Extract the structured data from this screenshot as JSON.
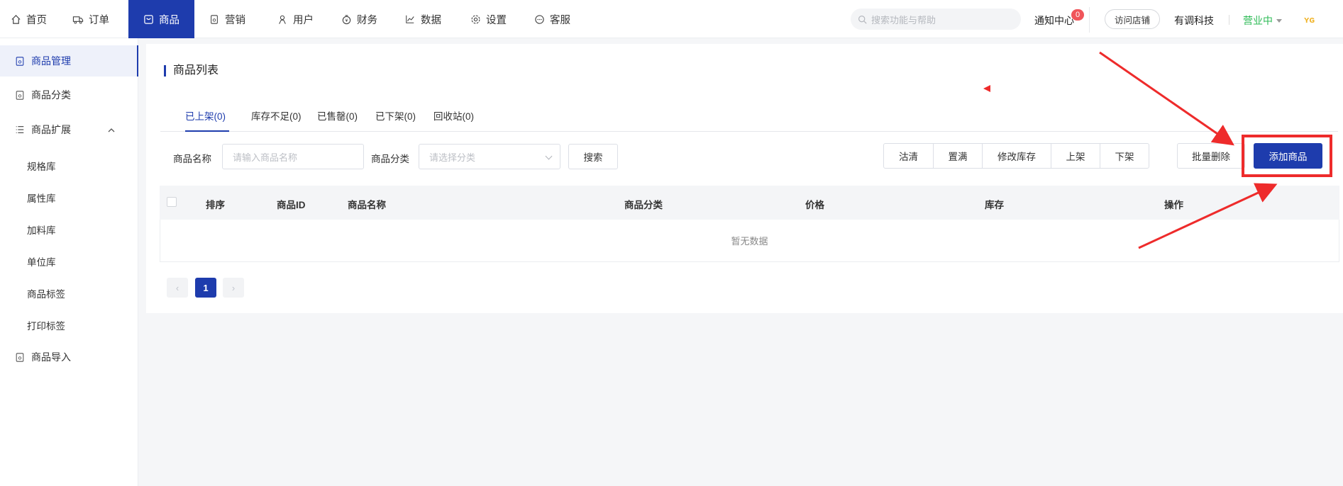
{
  "nav": {
    "items": [
      {
        "label": "首页",
        "icon": "home-icon"
      },
      {
        "label": "订单",
        "icon": "truck-icon"
      },
      {
        "label": "商品",
        "icon": "product-icon",
        "active": true
      },
      {
        "label": "营销",
        "icon": "marketing-icon"
      },
      {
        "label": "用户",
        "icon": "user-icon"
      },
      {
        "label": "财务",
        "icon": "money-icon"
      },
      {
        "label": "数据",
        "icon": "chart-icon"
      },
      {
        "label": "设置",
        "icon": "gear-icon"
      },
      {
        "label": "客服",
        "icon": "chat-icon"
      }
    ],
    "search_placeholder": "搜索功能与帮助",
    "notify_label": "通知中心",
    "notify_count": "0",
    "visit_store": "访问店铺",
    "company": "有调科技",
    "status": "营业中",
    "logo_text": "ʏɢ"
  },
  "sidebar": {
    "items": [
      {
        "label": "商品管理",
        "icon": "product-manage-icon",
        "active": true
      },
      {
        "label": "商品分类",
        "icon": "category-icon"
      },
      {
        "label": "商品扩展",
        "icon": "list-icon",
        "expanded": true
      },
      {
        "label": "商品导入",
        "icon": "import-icon"
      }
    ],
    "sub_items": [
      "规格库",
      "属性库",
      "加料库",
      "单位库",
      "商品标签",
      "打印标签"
    ]
  },
  "main": {
    "title": "商品列表",
    "tabs": [
      "已上架(0)",
      "库存不足(0)",
      "已售罄(0)",
      "已下架(0)",
      "回收站(0)"
    ],
    "filter": {
      "name_label": "商品名称",
      "name_placeholder": "请输入商品名称",
      "category_label": "商品分类",
      "category_placeholder": "请选择分类",
      "search_button": "搜索"
    },
    "actions": [
      "沽清",
      "置满",
      "修改库存",
      "上架",
      "下架"
    ],
    "batch_delete": "批量删除",
    "add_product": "添加商品",
    "table": {
      "columns": [
        "排序",
        "商品ID",
        "商品名称",
        "商品分类",
        "价格",
        "库存",
        "操作"
      ],
      "empty_text": "暂无数据"
    },
    "pagination": {
      "current": "1",
      "prev": "‹",
      "next": "›"
    }
  },
  "annotation_color": "#ee2b2b",
  "accent_color": "#1e3cad"
}
